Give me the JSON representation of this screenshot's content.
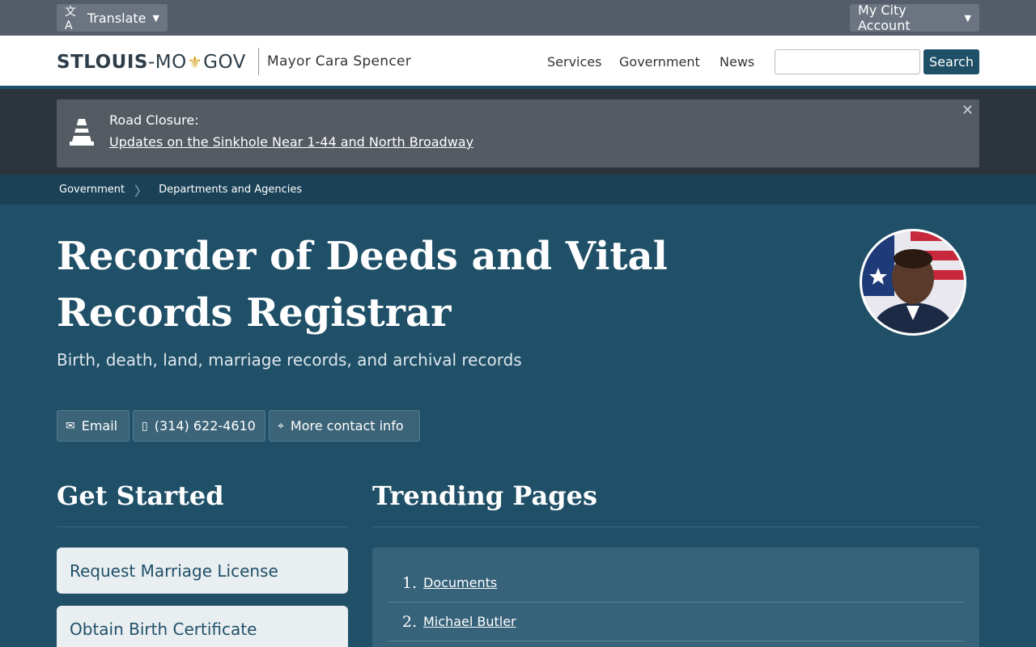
{
  "utility": {
    "translate_label": "Translate",
    "account_label": "My City Account"
  },
  "header": {
    "logo_bold": "STLOUIS",
    "logo_mid": "-MO",
    "logo_end": "GOV",
    "mayor": "Mayor Cara Spencer",
    "nav": [
      "Services",
      "Government",
      "News"
    ],
    "search_placeholder": "",
    "search_label": "Search"
  },
  "alert": {
    "label": "Road Closure:",
    "link": "Updates on the Sinkhole Near 1-44 and North Broadway",
    "close": "✕"
  },
  "breadcrumb": [
    "Government",
    "Departments and Agencies"
  ],
  "page": {
    "title": "Recorder of Deeds and Vital Records Registrar",
    "subtitle": "Birth, death, land, marriage records, and archival records"
  },
  "contact": {
    "email": "Email",
    "phone": "(314) 622-4610",
    "more": "More contact info"
  },
  "get_started": {
    "heading": "Get Started",
    "items": [
      "Request Marriage License",
      "Obtain Birth Certificate"
    ]
  },
  "trending": {
    "heading": "Trending Pages",
    "items": [
      {
        "num": "1.",
        "label": "Documents"
      },
      {
        "num": "2.",
        "label": "Michael Butler"
      }
    ]
  },
  "colors": {
    "brand": "#1f5068",
    "utility_bar": "#535c68",
    "alert_bg": "#545b63",
    "card_bg": "#e9eef1"
  }
}
